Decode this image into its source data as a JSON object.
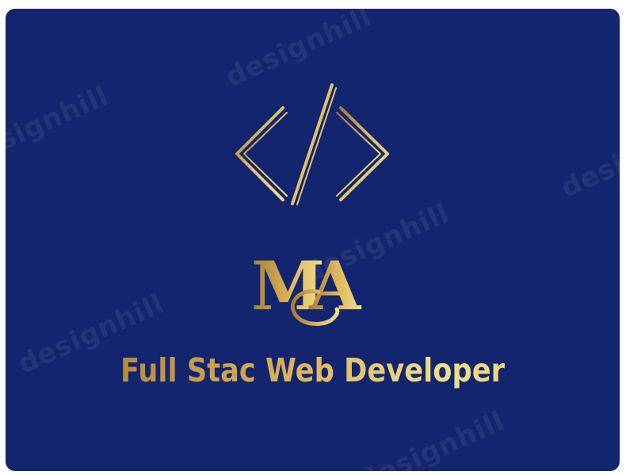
{
  "logo": {
    "code_symbol": "</>",
    "monogram_left": "M",
    "monogram_right": "A",
    "monogram_tail": "C",
    "tagline": "Full Stac Web Developer",
    "watermark": "designhill"
  },
  "colors": {
    "background": "#13256e",
    "gold_dark": "#a87a32",
    "gold_light": "#f1df8c"
  }
}
